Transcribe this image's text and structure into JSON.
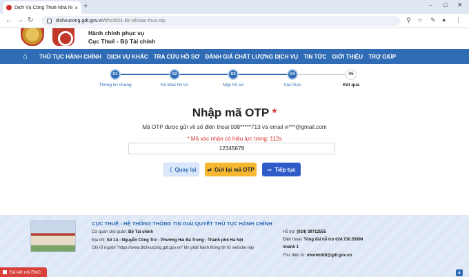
{
  "browser": {
    "tab_title": "Dịch Vụ Công Thuế Nhà Nước",
    "tab_close": "×",
    "new_tab": "+",
    "url_host": "dichvucong.gdt.gov.vn",
    "url_path": "/tthc/tk01-bk-stk/xac-thuc-otp"
  },
  "header": {
    "agency_line1": "Hành chính phục vụ",
    "agency_line2": "Cục Thuế - Bộ Tài chính"
  },
  "nav": {
    "items": [
      "THỦ TỤC HÀNH CHÍNH",
      "DỊCH VỤ KHÁC",
      "TRA CỨU HỒ SƠ",
      "ĐÁNH GIÁ CHẤT LƯỢNG DỊCH VỤ",
      "TIN TỨC",
      "GIỚI THIỆU",
      "TRỢ GIÚP"
    ]
  },
  "steps": [
    {
      "num": "01",
      "label": "Thông tin chung"
    },
    {
      "num": "02",
      "label": "Kê khai hồ sơ"
    },
    {
      "num": "03",
      "label": "Nộp hồ sơ"
    },
    {
      "num": "04",
      "label": "Xác thực"
    },
    {
      "num": "05",
      "label": "Kết quả"
    }
  ],
  "otp": {
    "title": "Nhập mã OTP",
    "required_mark": "*",
    "message": "Mã OTP được gửi về số điện thoại 098*****713 và email vi***@gmail.com",
    "timer": "* Mã xác nhận có hiệu lực trong: 112s",
    "value": "12345678"
  },
  "buttons": {
    "back": "Quay lại",
    "resend": "Gửi lại mã OTP",
    "next": "Tiếp tục"
  },
  "footer": {
    "title": "CỤC THUẾ - HỆ THỐNG THÔNG TIN GIẢI QUYẾT THỦ TỤC HÀNH CHÍNH",
    "managing_label": "Cơ quan chủ quản:",
    "managing_value": "Bộ Tài chính",
    "address_label": "Địa chỉ:",
    "address_value": "Số 1A - Nguyễn Công Trứ - Phường Hai Bà Trưng - Thành phố Hà Nội",
    "source_note": "Ghi rõ nguồn \"https://www.dichvucong.gdt.gov.vn\" khi phát hành thông tin từ website này",
    "support_label": "Hỗ trợ:",
    "support_value": "(024) 39712555",
    "phone_label": "Điện thoại:",
    "phone_value": "Tổng đài hỗ trợ 024.730.55999",
    "phone_ext": "nhánh 1",
    "email_label": "Thư điện tử:",
    "email_value": "nhomhttdt@gdt.gov.vn"
  },
  "badge": {
    "label": "Đã kết nối EMC"
  },
  "colors": {
    "primary": "#2f6cb5",
    "accent_red": "#d32f2f",
    "resend_yellow": "#f6b831",
    "next_blue": "#2f5bc9",
    "footer_bg": "#dde7f6"
  }
}
